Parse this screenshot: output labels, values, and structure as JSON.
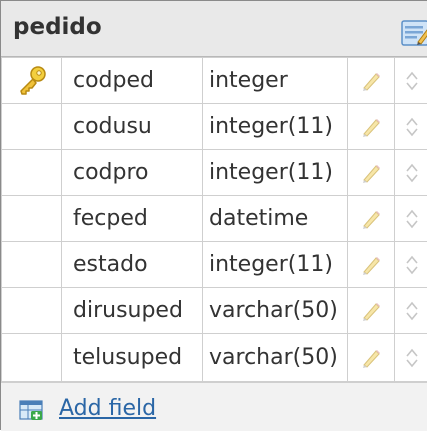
{
  "table": {
    "title": "pedido"
  },
  "fields": [
    {
      "name": "codped",
      "type": "integer",
      "primary_key": true
    },
    {
      "name": "codusu",
      "type": "integer(11)",
      "primary_key": false
    },
    {
      "name": "codpro",
      "type": "integer(11)",
      "primary_key": false
    },
    {
      "name": "fecped",
      "type": "datetime",
      "primary_key": false
    },
    {
      "name": "estado",
      "type": "integer(11)",
      "primary_key": false
    },
    {
      "name": "dirusuped",
      "type": "varchar(50)",
      "primary_key": false
    },
    {
      "name": "telusuped",
      "type": "varchar(50)",
      "primary_key": false
    }
  ],
  "footer": {
    "add_label": "Add field"
  },
  "icons": {
    "header": "edit-table-icon",
    "key": "key-icon",
    "edit": "pencil-icon",
    "move": "up-down-arrows-icon",
    "add": "add-field-icon"
  },
  "colors": {
    "header_bg": "#e9e9e9",
    "link": "#2a66a6",
    "key": "#e0b52a"
  }
}
